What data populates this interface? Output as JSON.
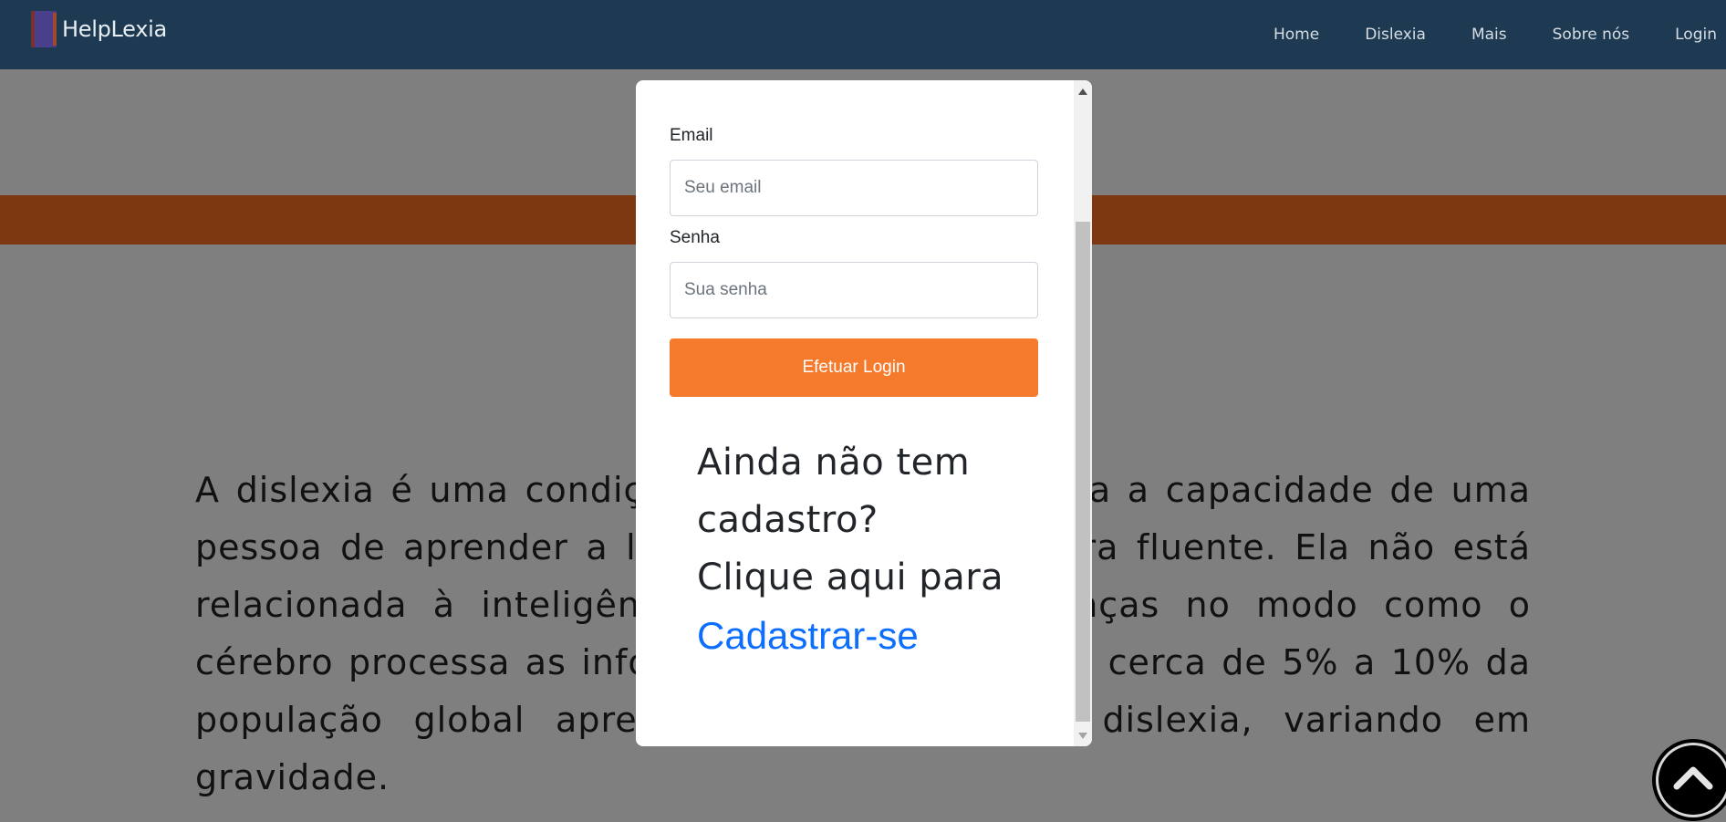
{
  "navbar": {
    "brand": "HelpLexia",
    "links": [
      "Home",
      "Dislexia",
      "Mais",
      "Sobre nós",
      "Login"
    ]
  },
  "content": {
    "intro": "A dislexia é uma condição neurológica que afeta a capacidade de uma pessoa de aprender a ler e escrever de maneira fluente. Ela não está relacionada à inteligência, mas sim a diferenças no modo como o cérebro processa as informações. Estima-se que cerca de 5% a 10% da população global apresente algum grau de dislexia, variando em gravidade."
  },
  "login_modal": {
    "email_label": "Email",
    "email_placeholder": "Seu email",
    "password_label": "Senha",
    "password_placeholder": "Sua senha",
    "login_button": "Efetuar Login",
    "signup_prompt_1": "Ainda não tem cadastro?",
    "signup_prompt_2": "Clique aqui para",
    "signup_link": "Cadastrar-se"
  },
  "icons": {
    "brand": "book-icon",
    "back_to_top": "chevron-up-icon"
  },
  "colors": {
    "navbar": "#1e3a52",
    "accent": "#f67a2c",
    "band": "#fb6f22",
    "link": "#0d6efd"
  }
}
